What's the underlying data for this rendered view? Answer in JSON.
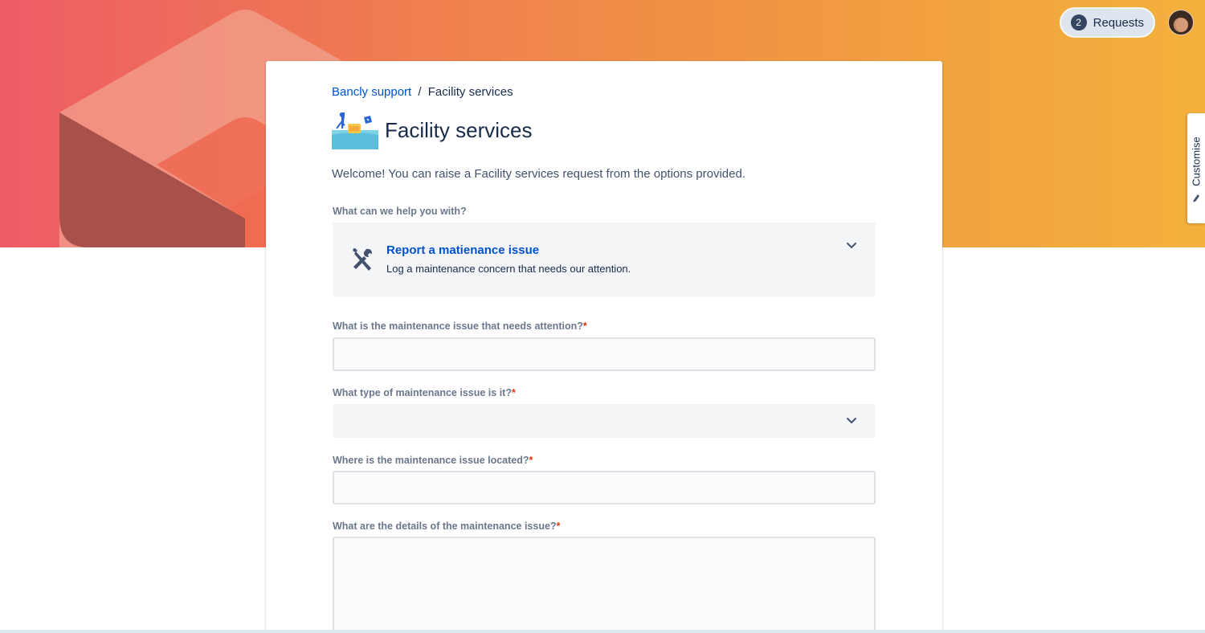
{
  "header": {
    "requests_label": "Requests",
    "requests_count": "2",
    "customise_label": "Customise"
  },
  "breadcrumb": {
    "root": "Bancly support",
    "separator": "/",
    "current": "Facility services"
  },
  "page": {
    "title": "Facility services",
    "welcome": "Welcome! You can raise a Facility services request from the options provided."
  },
  "request_type": {
    "label": "What can we help you with?",
    "selected_title": "Report a matienance issue",
    "selected_description": "Log a maintenance concern that needs our attention."
  },
  "form": {
    "fields": [
      {
        "label": "What is the maintenance issue that needs attention?",
        "required": "*",
        "value": ""
      },
      {
        "label": "What type of maintenance issue is it?",
        "required": "*",
        "value": ""
      },
      {
        "label": "Where is the maintenance issue located?",
        "required": "*",
        "value": ""
      },
      {
        "label": "What are the details of the maintenance issue?",
        "required": "*",
        "value": ""
      }
    ]
  },
  "colors": {
    "banner_start": "#ee5c66",
    "banner_end": "#f4b13c",
    "link": "#0052cc",
    "required": "#de350b"
  },
  "icons": {
    "service": "toolbox-icon",
    "request_type": "tools-icon",
    "dropdown": "chevron-down-icon",
    "customise": "pencil-icon"
  }
}
